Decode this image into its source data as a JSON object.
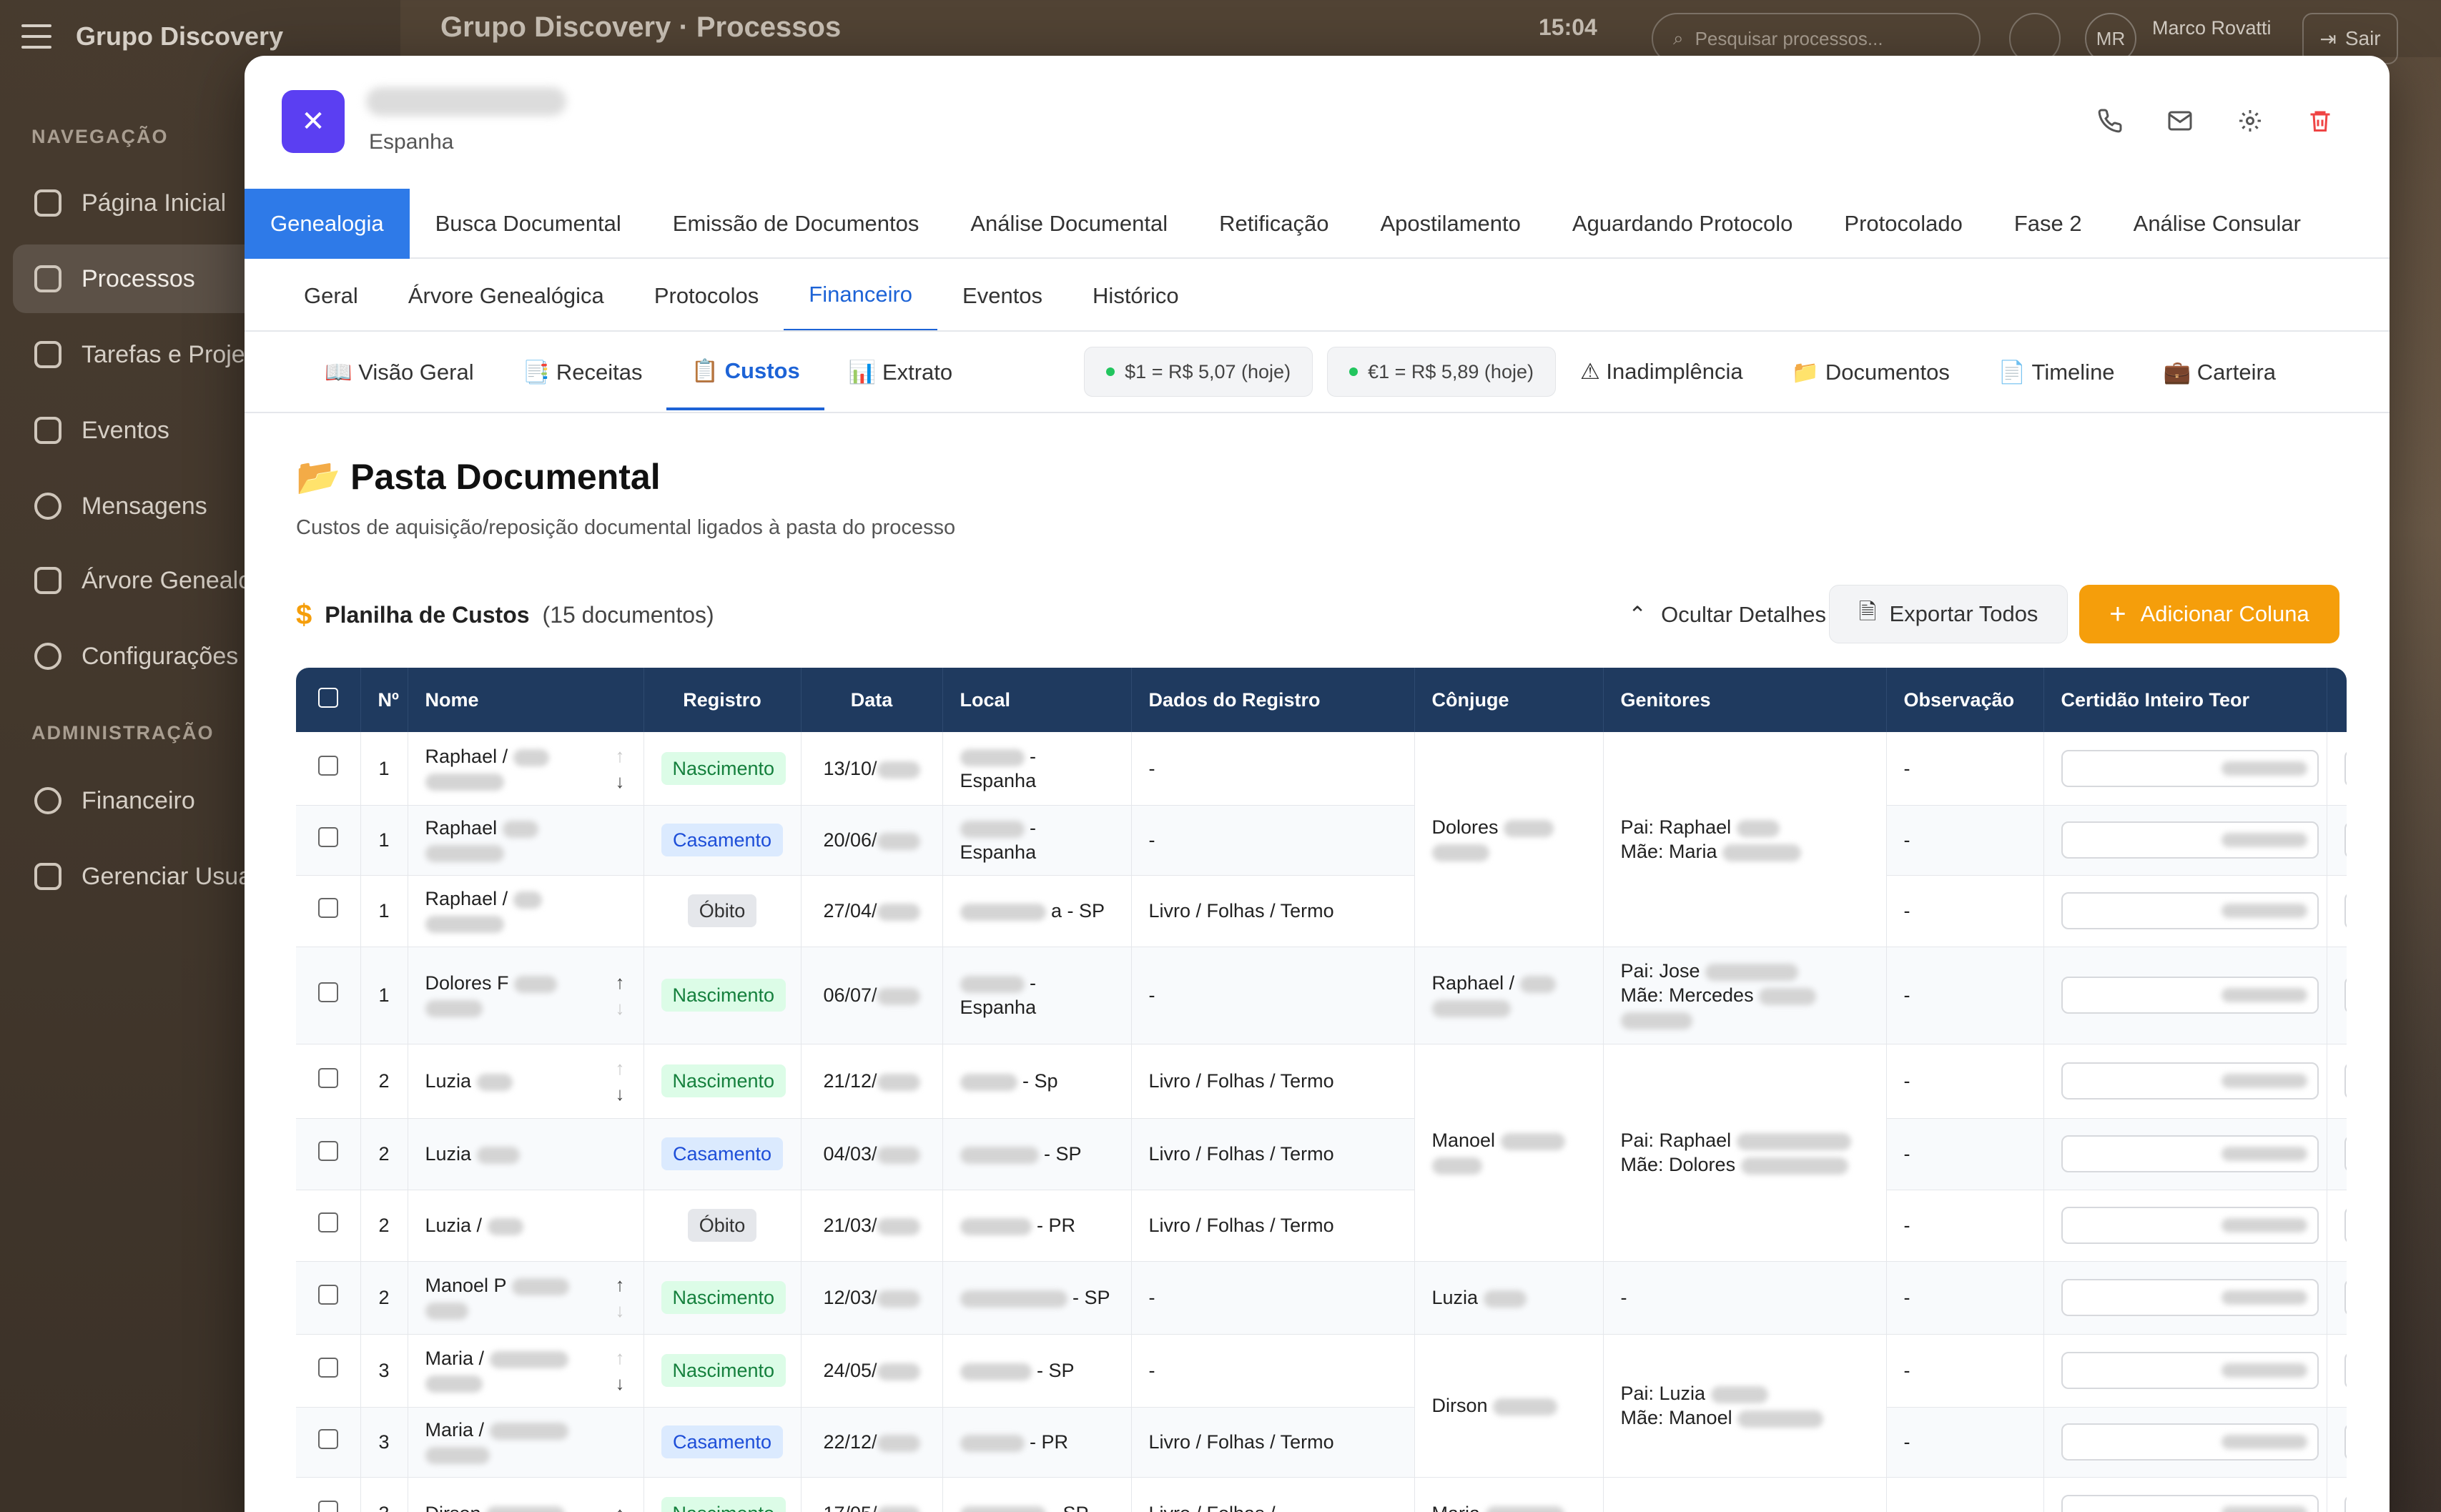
{
  "app": {
    "brand": "Grupo Discovery",
    "page_title": "Grupo Discovery · Processos",
    "clock": "15:04",
    "search_placeholder": "Pesquisar processos...",
    "user_initials": "MR",
    "user_name": "Marco Rovatti",
    "logout": "Sair"
  },
  "sidebar": {
    "section_nav": "NAVEGAÇÃO",
    "section_admin": "ADMINISTRAÇÃO",
    "items": [
      {
        "label": "Página Inicial",
        "icon": "home-icon"
      },
      {
        "label": "Processos",
        "icon": "folder-icon",
        "active": true
      },
      {
        "label": "Tarefas e Proje",
        "icon": "check-square-icon"
      },
      {
        "label": "Eventos",
        "icon": "calendar-icon"
      },
      {
        "label": "Mensagens",
        "icon": "chat-icon"
      },
      {
        "label": "Árvore Genealo",
        "icon": "tree-icon"
      },
      {
        "label": "Configurações",
        "icon": "gear-icon"
      }
    ],
    "admin_items": [
      {
        "label": "Financeiro",
        "icon": "dollar-icon"
      },
      {
        "label": "Gerenciar Usua",
        "icon": "shield-icon"
      }
    ]
  },
  "modal": {
    "country": "Espanha",
    "stage_tabs": [
      "Genealogia",
      "Busca Documental",
      "Emissão de Documentos",
      "Análise Documental",
      "Retificação",
      "Apostilamento",
      "Aguardando Protocolo",
      "Protocolado",
      "Fase 2",
      "Análise Consular"
    ],
    "section_tabs": [
      "Geral",
      "Árvore Genealógica",
      "Protocolos",
      "Financeiro",
      "Eventos",
      "Histórico"
    ],
    "finance_tabs": [
      "📖 Visão Geral",
      "📑 Receitas",
      "📋 Custos",
      "📊 Extrato"
    ],
    "rate_usd": "$1 = R$ 5,07 (hoje)",
    "rate_eur": "€1 = R$ 5,89 (hoje)",
    "extra_tabs": [
      "⚠ Inadimplência",
      "📁 Documentos",
      "📄 Timeline",
      "💼 Carteira"
    ],
    "section_title": "📂 Pasta Documental",
    "section_subtitle": "Custos de aquisição/reposição documental ligados à pasta do processo",
    "sheet_label": "Planilha de Custos",
    "sheet_count": "(15 documentos)",
    "hide_details": "Ocultar Detalhes",
    "export_all": "Exportar Todos",
    "add_column": "Adicionar Coluna"
  },
  "table": {
    "headers": [
      "Nº",
      "Nome",
      "Registro",
      "Data",
      "Local",
      "Dados do Registro",
      "Cônjuge",
      "Genitores",
      "Observação",
      "Certidão Inteiro Teor"
    ],
    "rows": [
      {
        "n": "1",
        "name": "Raphael /",
        "reg": "Nascimento",
        "date": "13/10/",
        "local": "- Espanha",
        "dados": "-",
        "obs": "-"
      },
      {
        "n": "1",
        "name": "Raphael",
        "reg": "Casamento",
        "date": "20/06/",
        "local": "- Espanha",
        "dados": "-",
        "obs": "-"
      },
      {
        "n": "1",
        "name": "Raphael /",
        "reg": "Óbito",
        "date": "27/04/",
        "local": "a - SP",
        "dados": "Livro / Folhas / Termo",
        "obs": "-"
      },
      {
        "n": "1",
        "name": "Dolores F",
        "reg": "Nascimento",
        "date": "06/07/",
        "local": "- Espanha",
        "dados": "-",
        "obs": "-"
      },
      {
        "n": "2",
        "name": "Luzia",
        "reg": "Nascimento",
        "date": "21/12/",
        "local": "- Sp",
        "dados": "Livro / Folhas / Termo",
        "obs": "-"
      },
      {
        "n": "2",
        "name": "Luzia",
        "reg": "Casamento",
        "date": "04/03/",
        "local": "- SP",
        "dados": "Livro / Folhas / Termo",
        "obs": "-"
      },
      {
        "n": "2",
        "name": "Luzia /",
        "reg": "Óbito",
        "date": "21/03/",
        "local": "- PR",
        "dados": "Livro / Folhas / Termo",
        "obs": "-"
      },
      {
        "n": "2",
        "name": "Manoel P",
        "reg": "Nascimento",
        "date": "12/03/",
        "local": "- SP",
        "dados": "-",
        "obs": "-"
      },
      {
        "n": "3",
        "name": "Maria /",
        "reg": "Nascimento",
        "date": "24/05/",
        "local": "- SP",
        "dados": "-",
        "obs": "-"
      },
      {
        "n": "3",
        "name": "Maria /",
        "reg": "Casamento",
        "date": "22/12/",
        "local": "- PR",
        "dados": "Livro / Folhas / Termo",
        "obs": "-"
      },
      {
        "n": "3",
        "name": "Dirson",
        "reg": "Nascimento",
        "date": "17/05/",
        "local": "- SP",
        "dados": "Livro / Folhas /",
        "obs": "-"
      }
    ],
    "spouse_groups": {
      "g1": "Dolores",
      "g2": "Raphael /",
      "g3": "Manoel",
      "g4": "Luzia",
      "g5": "Dirson",
      "g6": "Maria"
    },
    "parent_groups": {
      "g1": [
        "Pai: Raphael",
        "Mãe: Maria"
      ],
      "g2": [
        "Pai: Jose",
        "Mãe: Mercedes"
      ],
      "g3": [
        "Pai: Raphael",
        "Mãe: Dolores"
      ],
      "g4": "-",
      "g5": [
        "Pai: Luzia",
        "Mãe: Manoel"
      ]
    }
  }
}
